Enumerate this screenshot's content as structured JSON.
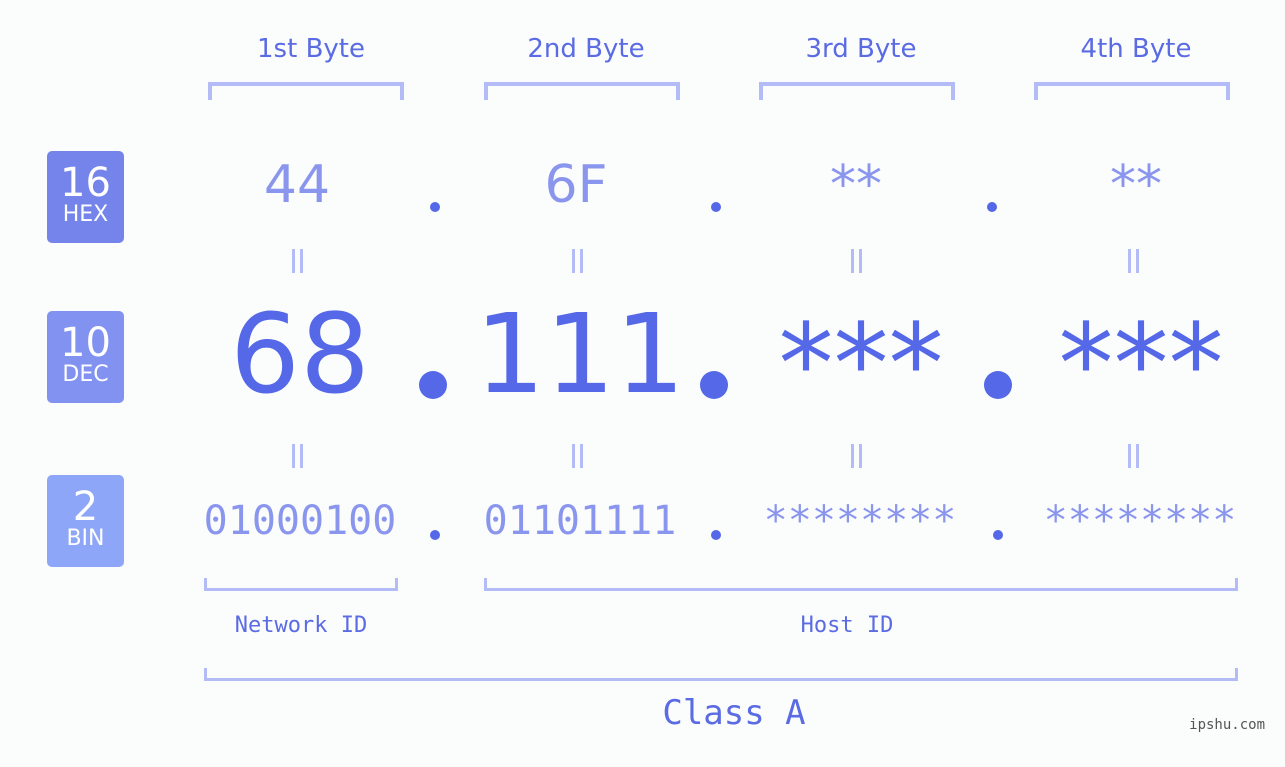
{
  "badges": [
    {
      "num": "16",
      "label": "HEX",
      "color": "#7484ea"
    },
    {
      "num": "10",
      "label": "DEC",
      "color": "#8292f0"
    },
    {
      "num": "2",
      "label": "BIN",
      "color": "#8ea6f8"
    }
  ],
  "bytes": [
    {
      "header": "1st Byte",
      "hex": "44",
      "dec": "68",
      "bin": "01000100"
    },
    {
      "header": "2nd Byte",
      "hex": "6F",
      "dec": "111",
      "bin": "01101111"
    },
    {
      "header": "3rd Byte",
      "hex": "**",
      "dec": "***",
      "bin": "********"
    },
    {
      "header": "4th Byte",
      "hex": "**",
      "dec": "***",
      "bin": "********"
    }
  ],
  "labels": {
    "network_id": "Network ID",
    "host_id": "Host ID",
    "class": "Class A"
  },
  "watermark": "ipshu.com",
  "colors": {
    "accent": "#5468e8",
    "light": "#b3bcf6"
  }
}
